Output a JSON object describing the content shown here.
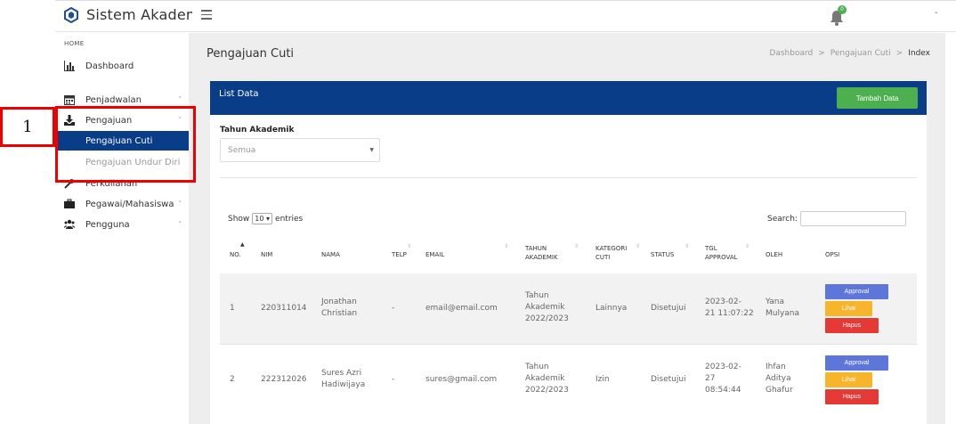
{
  "app": {
    "title": "Sistem Akademik",
    "notification_count": "0",
    "user_caret": "-"
  },
  "sidebar": {
    "heading": "HOME",
    "items": [
      {
        "label": "Dashboard",
        "icon": "bar-chart-icon",
        "caret": ""
      },
      {
        "label": "Penjadwalan",
        "icon": "calendar-icon",
        "caret": "˅"
      },
      {
        "label": "Pengajuan",
        "icon": "download-icon",
        "caret": "˅"
      },
      {
        "label": "Perkuliahan",
        "icon": "wrench-icon",
        "caret": ""
      },
      {
        "label": "Pegawai/Mahasiswa",
        "icon": "briefcase-icon",
        "caret": "˅"
      },
      {
        "label": "Pengguna",
        "icon": "users-icon",
        "caret": "˅"
      }
    ],
    "submenu": [
      {
        "label": "Pengajuan Cuti",
        "active": true
      },
      {
        "label": "Pengajuan Undur Diri",
        "active": false
      }
    ]
  },
  "page": {
    "title": "Pengajuan Cuti",
    "breadcrumb": [
      "Dashboard",
      ">",
      "Pengajuan Cuti",
      ">",
      "Index"
    ]
  },
  "card": {
    "title": "List Data",
    "add_button": "Tambah Data",
    "filter_label": "Tahun Akademik",
    "filter_value": "Semua"
  },
  "table": {
    "show_label": "Show",
    "entries_value": "10",
    "entries_label": "entries",
    "search_label": "Search:",
    "headers": {
      "no": "NO.",
      "nim": "NIM",
      "nama": "NAMA",
      "telp": "TELP",
      "email": "EMAIL",
      "tahun1": "TAHUN",
      "tahun2": "AKADEMIK",
      "kat1": "KATEGORI",
      "kat2": "CUTI",
      "status": "STATUS",
      "tgl1": "TGL",
      "tgl2": "APPROVAL",
      "oleh": "OLEH",
      "opsi": "OPSI"
    },
    "rows": [
      {
        "no": "1",
        "nim": "220311014",
        "nama1": "Jonathan",
        "nama2": "Christian",
        "nama3": "",
        "telp": "-",
        "email": "email@email.com",
        "tahun1": "Tahun",
        "tahun2": "Akademik",
        "tahun3": "2022/2023",
        "kategori": "Lainnya",
        "status": "Disetujui",
        "tgl1": "2023-02-",
        "tgl2": "21 11:07:22",
        "tgl3": "",
        "oleh1": "Yana",
        "oleh2": "Mulyana",
        "oleh3": ""
      },
      {
        "no": "2",
        "nim": "222312026",
        "nama1": "Sures Azri",
        "nama2": "Hadiwijaya",
        "nama3": "",
        "telp": "-",
        "email": "sures@gmail.com",
        "tahun1": "Tahun",
        "tahun2": "Akademik",
        "tahun3": "2022/2023",
        "kategori": "Izin",
        "status": "Disetujui",
        "tgl1": "2023-02-",
        "tgl2": "27",
        "tgl3": "08:54:44",
        "oleh1": "Ihfan",
        "oleh2": "Aditya",
        "oleh3": "Ghafur"
      }
    ],
    "options": {
      "approval": "Approval",
      "lihat": "Lihat",
      "hapus": "Hapus"
    }
  },
  "annotation": {
    "number": "1",
    "color": "#ee0000"
  },
  "colors": {
    "primary": "#0a3d88",
    "success": "#4caf50",
    "approval": "#5e75d9",
    "warning": "#f7b52c",
    "danger": "#e53935"
  }
}
